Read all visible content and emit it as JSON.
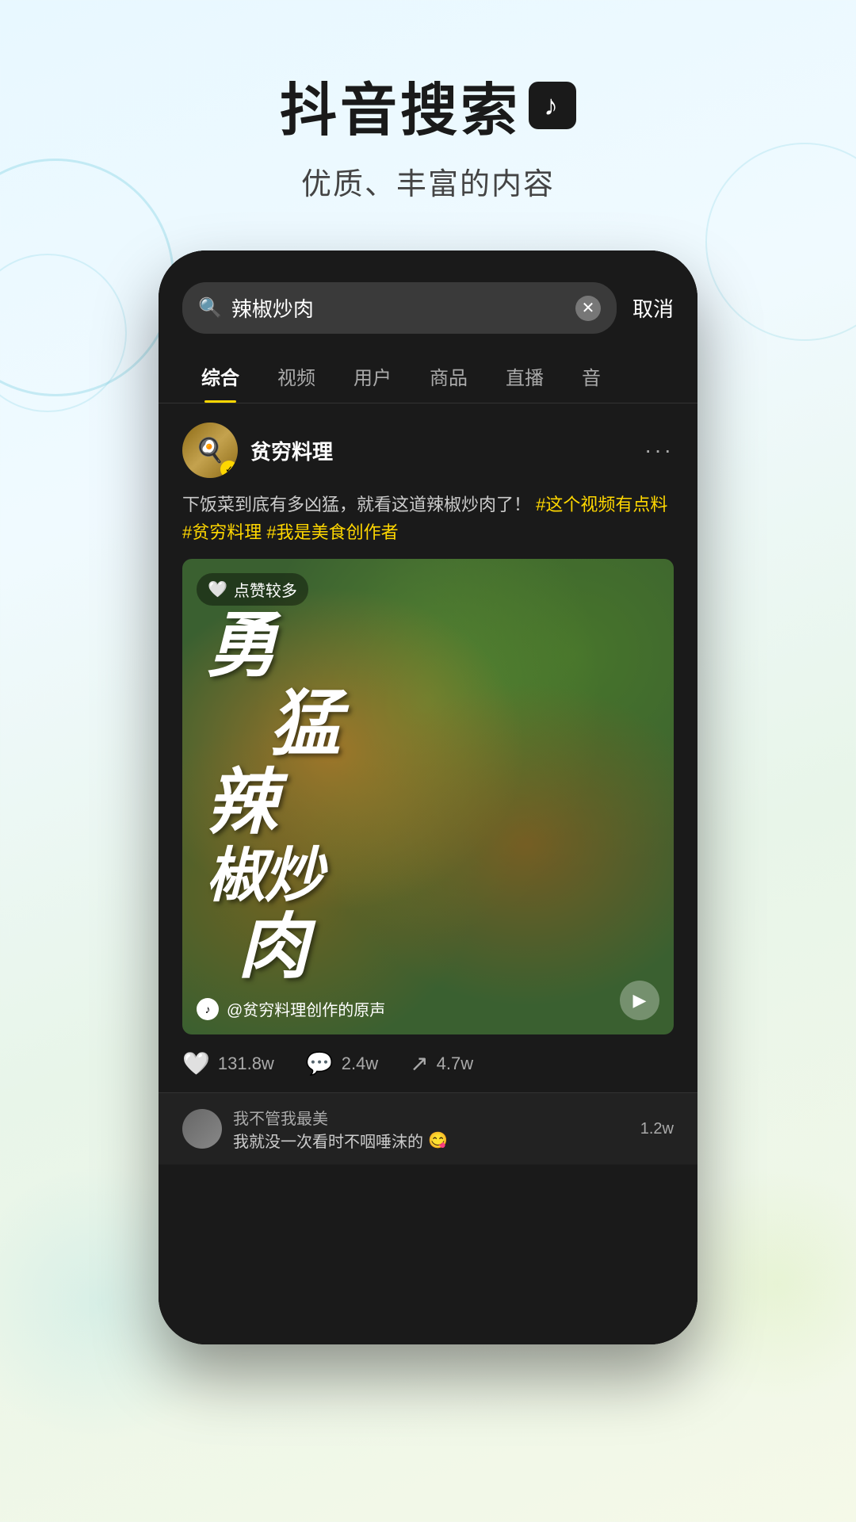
{
  "header": {
    "main_title": "抖音搜索",
    "subtitle": "优质、丰富的内容"
  },
  "phone": {
    "search_bar": {
      "query": "辣椒炒肉",
      "cancel_label": "取消"
    },
    "tabs": [
      {
        "label": "综合",
        "active": true
      },
      {
        "label": "视频",
        "active": false
      },
      {
        "label": "用户",
        "active": false
      },
      {
        "label": "商品",
        "active": false
      },
      {
        "label": "直播",
        "active": false
      },
      {
        "label": "音",
        "active": false
      }
    ],
    "post": {
      "author": "贫穷料理",
      "description": "下饭菜到底有多凶猛，就看这道辣椒炒肉了！",
      "hashtags": [
        "#这个视频有点料",
        "#贫穷料理",
        "#我是美食创作者"
      ],
      "video_text_line1": "勇",
      "video_text_line2": "猛",
      "video_text_line3": "辣",
      "video_text_line4": "椒炒",
      "video_text_line5": "肉",
      "likes_badge": "点赞较多",
      "audio_label": "@贫穷料理创作的原声",
      "engagement": {
        "likes": "131.8w",
        "comments": "2.4w",
        "shares": "4.7w"
      }
    },
    "comments": [
      {
        "author": "我不管我最美",
        "content": "我就没一次看时不咽唾沫的",
        "emoji": "😋",
        "likes": "1.2w"
      }
    ]
  }
}
